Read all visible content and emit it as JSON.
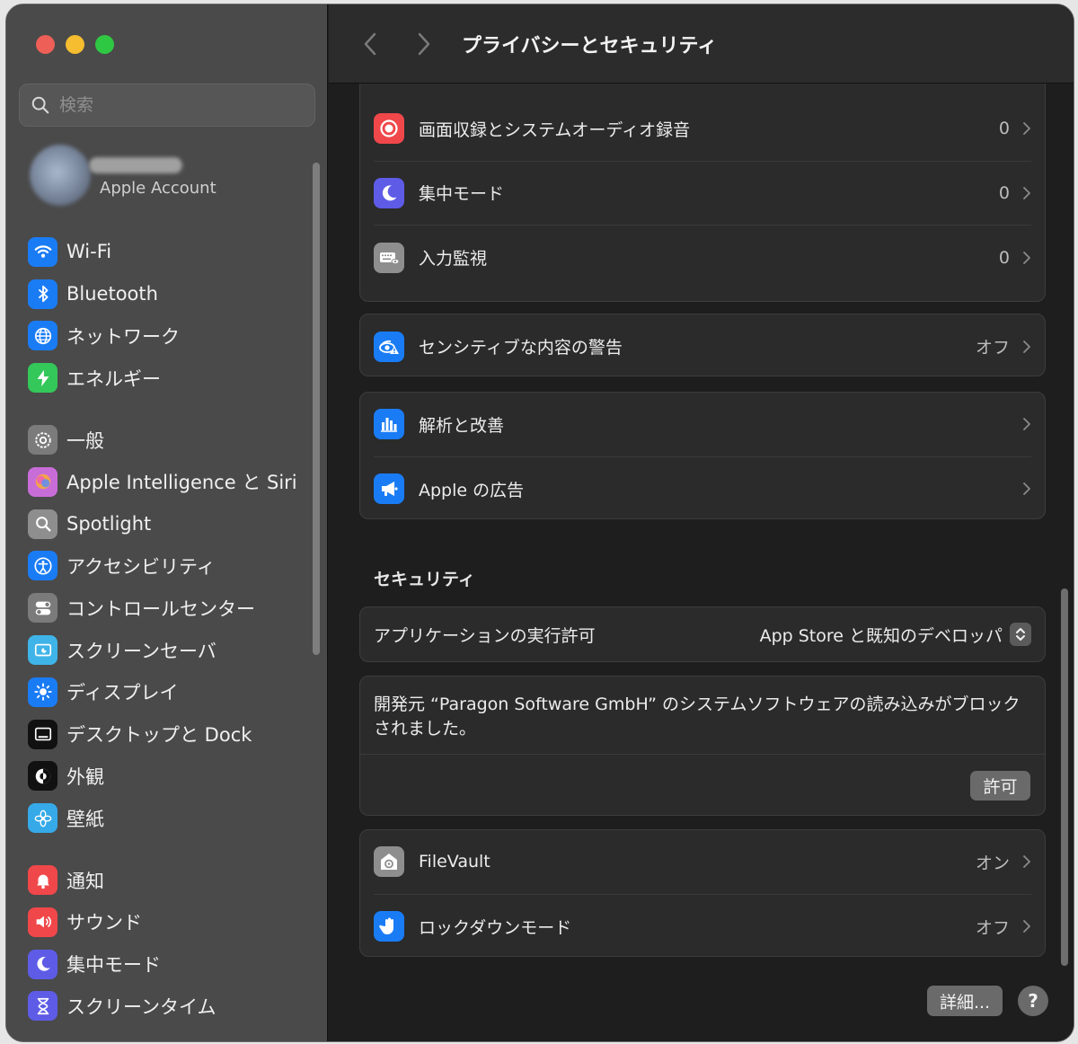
{
  "window": {
    "title": "プライバシーとセキュリティ"
  },
  "sidebar": {
    "search_placeholder": "検索",
    "account_label": "Apple Account",
    "groups": [
      [
        {
          "label": "Wi-Fi",
          "icon": "wifi-icon",
          "color": "#1a7cf5"
        },
        {
          "label": "Bluetooth",
          "icon": "bluetooth-icon",
          "color": "#1a7cf5"
        },
        {
          "label": "ネットワーク",
          "icon": "globe-icon",
          "color": "#1a7cf5"
        },
        {
          "label": "エネルギー",
          "icon": "bolt-icon",
          "color": "#34c759"
        }
      ],
      [
        {
          "label": "一般",
          "icon": "gear-icon",
          "color": "#7b7b7b"
        },
        {
          "label": "Apple Intelligence と Siri",
          "icon": "siri-icon",
          "color": "#c86dd7"
        },
        {
          "label": "Spotlight",
          "icon": "magnifier-icon",
          "color": "#8e8e8e"
        },
        {
          "label": "アクセシビリティ",
          "icon": "accessibility-icon",
          "color": "#1a7cf5"
        },
        {
          "label": "コントロールセンター",
          "icon": "toggles-icon",
          "color": "#7b7b7b"
        },
        {
          "label": "スクリーンセーバ",
          "icon": "screensaver-icon",
          "color": "#3fb4e8"
        },
        {
          "label": "ディスプレイ",
          "icon": "sun-icon",
          "color": "#1a7cf5"
        },
        {
          "label": "デスクトップと Dock",
          "icon": "dock-icon",
          "color": "#111111"
        },
        {
          "label": "外観",
          "icon": "appearance-icon",
          "color": "#111111"
        },
        {
          "label": "壁紙",
          "icon": "flower-icon",
          "color": "#36a9e8"
        }
      ],
      [
        {
          "label": "通知",
          "icon": "bell-icon",
          "color": "#f0474a"
        },
        {
          "label": "サウンド",
          "icon": "speaker-icon",
          "color": "#f0474a"
        },
        {
          "label": "集中モード",
          "icon": "moon-icon",
          "color": "#5e5ce6"
        },
        {
          "label": "スクリーンタイム",
          "icon": "hourglass-icon",
          "color": "#5e5ce6"
        }
      ]
    ]
  },
  "privacy_card": [
    {
      "label": "画面収録とシステムオーディオ録音",
      "value": "0",
      "icon": "record-icon",
      "color": "#f0474a"
    },
    {
      "label": "集中モード",
      "value": "0",
      "icon": "moon-icon",
      "color": "#5e5ce6"
    },
    {
      "label": "入力監視",
      "value": "0",
      "icon": "keyboard-eye-icon",
      "color": "#8e8e8e"
    }
  ],
  "sensitive_card": [
    {
      "label": "センシティブな内容の警告",
      "value": "オフ",
      "icon": "eye-warning-icon",
      "color": "#1a7cf5"
    }
  ],
  "analytics_card": [
    {
      "label": "解析と改善",
      "value": "",
      "icon": "chart-bars-icon",
      "color": "#1a7cf5"
    },
    {
      "label": "Apple の広告",
      "value": "",
      "icon": "megaphone-icon",
      "color": "#1a7cf5"
    }
  ],
  "security": {
    "title": "セキュリティ",
    "allow_apps_label": "アプリケーションの実行許可",
    "allow_apps_value": "App Store と既知のデベロッパ",
    "block_message": "開発元 “Paragon Software GmbH” のシステムソフトウェアの読み込みがブロックされました。",
    "allow_button": "許可"
  },
  "security_card": [
    {
      "label": "FileVault",
      "value": "オン",
      "icon": "filevault-icon",
      "color": "#8e8e8e"
    },
    {
      "label": "ロックダウンモード",
      "value": "オフ",
      "icon": "hand-icon",
      "color": "#1a7cf5"
    }
  ],
  "footer": {
    "details_button": "詳細...",
    "help_button": "?"
  }
}
